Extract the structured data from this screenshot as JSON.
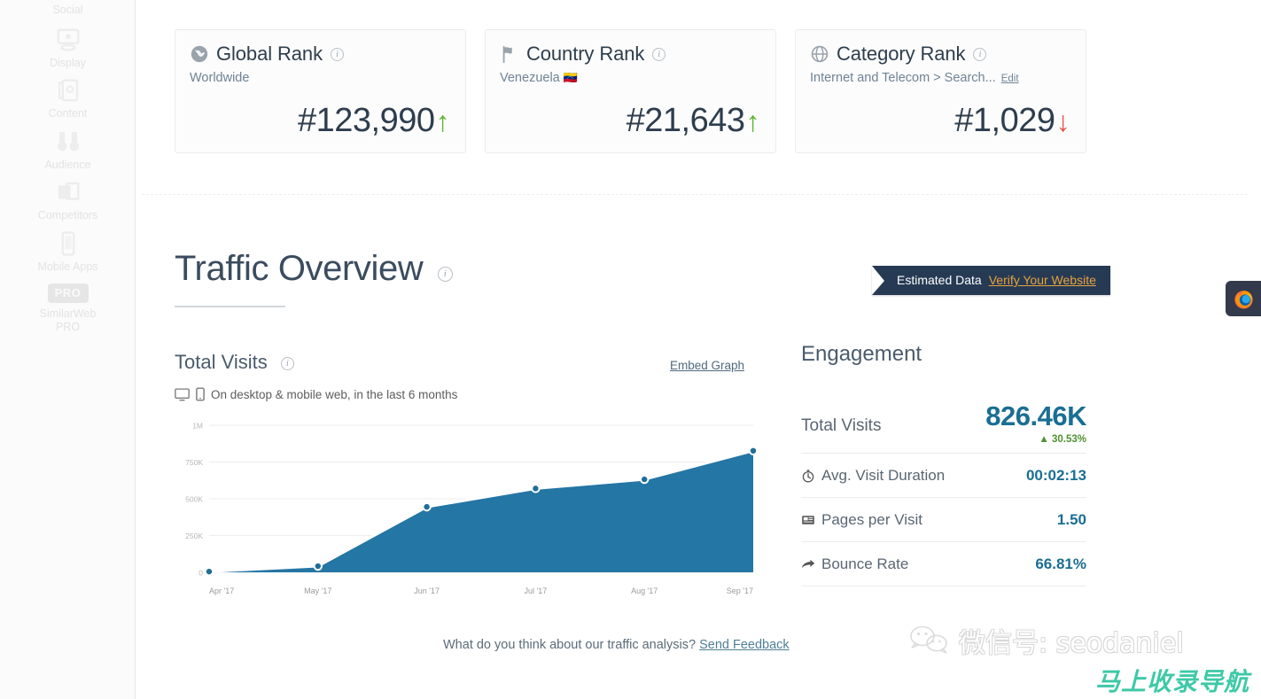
{
  "sidebar": {
    "items": [
      {
        "label": "Social",
        "icon": "social-icon"
      },
      {
        "label": "Display",
        "icon": "display-ads-icon"
      },
      {
        "label": "Content",
        "icon": "content-icon"
      },
      {
        "label": "Audience",
        "icon": "binoculars-icon"
      },
      {
        "label": "Competitors",
        "icon": "competitors-icon"
      },
      {
        "label": "Mobile Apps",
        "icon": "mobile-apps-icon"
      },
      {
        "label": "SimilarWeb\nPRO",
        "icon": "pro-badge-icon",
        "badge": "PRO"
      }
    ],
    "pro_badge_label": "PRO",
    "pro_line1": "SimilarWeb",
    "pro_line2": "PRO"
  },
  "rank_cards": [
    {
      "id": "global-rank",
      "icon": "globe-americas-icon",
      "title": "Global Rank",
      "subtitle": "Worldwide",
      "value": "#123,990",
      "trend": "up",
      "trend_glyph": "↑",
      "trend_color": "#5cb531"
    },
    {
      "id": "country-rank",
      "icon": "flag-icon",
      "title": "Country Rank",
      "subtitle": "Venezuela",
      "flag": "🇻🇪",
      "value": "#21,643",
      "trend": "up",
      "trend_glyph": "↑",
      "trend_color": "#5cb531"
    },
    {
      "id": "category-rank",
      "icon": "globe-grid-icon",
      "title": "Category Rank",
      "subtitle": "Internet and Telecom > Search...",
      "edit_label": "Edit",
      "value": "#1,029",
      "trend": "down",
      "trend_glyph": "↓",
      "trend_color": "#e8514b"
    }
  ],
  "traffic": {
    "heading": "Traffic Overview",
    "estimated_label": "Estimated Data",
    "verify_label": "Verify Your Website",
    "total_visits_heading": "Total Visits",
    "embed_graph_label": "Embed Graph",
    "device_note": "On desktop & mobile web, in the last 6 months"
  },
  "engagement": {
    "heading": "Engagement",
    "rows": [
      {
        "label": "Total Visits",
        "value": "826.46K",
        "delta": "30.53%",
        "delta_glyph": "▲",
        "icon": null,
        "hero": true
      },
      {
        "label": "Avg. Visit Duration",
        "value": "00:02:13",
        "icon": "stopwatch-icon"
      },
      {
        "label": "Pages per Visit",
        "value": "1.50",
        "icon": "pages-icon"
      },
      {
        "label": "Bounce Rate",
        "value": "66.81%",
        "icon": "bounce-arrow-icon"
      }
    ]
  },
  "footer": {
    "feedback_question": "What do you think about our traffic analysis?",
    "feedback_link": "Send Feedback"
  },
  "watermarks": {
    "wechat_text": "微信号: seodaniel",
    "green_text": "马上收录导航"
  },
  "browser_tab": {
    "icon": "firefox-icon"
  },
  "colors": {
    "chart_fill": "#2476a4",
    "chart_line": "#ffffff",
    "marker": "#1f6e97",
    "accent_blue": "#1a6e93",
    "ribbon_bg": "#263a54",
    "verify_orange": "#e8a33d",
    "up_green": "#5cb531",
    "down_red": "#e8514b",
    "delta_green": "#4f9131"
  },
  "chart_data": {
    "type": "area",
    "title": "Total Visits",
    "subtitle": "On desktop & mobile web, in the last 6 months",
    "xlabel": "",
    "ylabel": "",
    "categories": [
      "Apr '17",
      "May '17",
      "Jun '17",
      "Jul '17",
      "Aug '17",
      "Sep '17"
    ],
    "x_ticks": [
      "Apr '17",
      "May '17",
      "Jun '17",
      "Jul '17",
      "Aug '17",
      "Sep '17"
    ],
    "y_ticks": [
      "0",
      "250K",
      "500K",
      "750K",
      "1M"
    ],
    "y_tick_values": [
      0,
      250000,
      500000,
      750000,
      1000000
    ],
    "ylim": [
      0,
      1000000
    ],
    "grid": true,
    "legend": "none",
    "series": [
      {
        "name": "Total Visits",
        "values": [
          5000,
          42000,
          445000,
          570000,
          632000,
          826460
        ]
      }
    ]
  }
}
